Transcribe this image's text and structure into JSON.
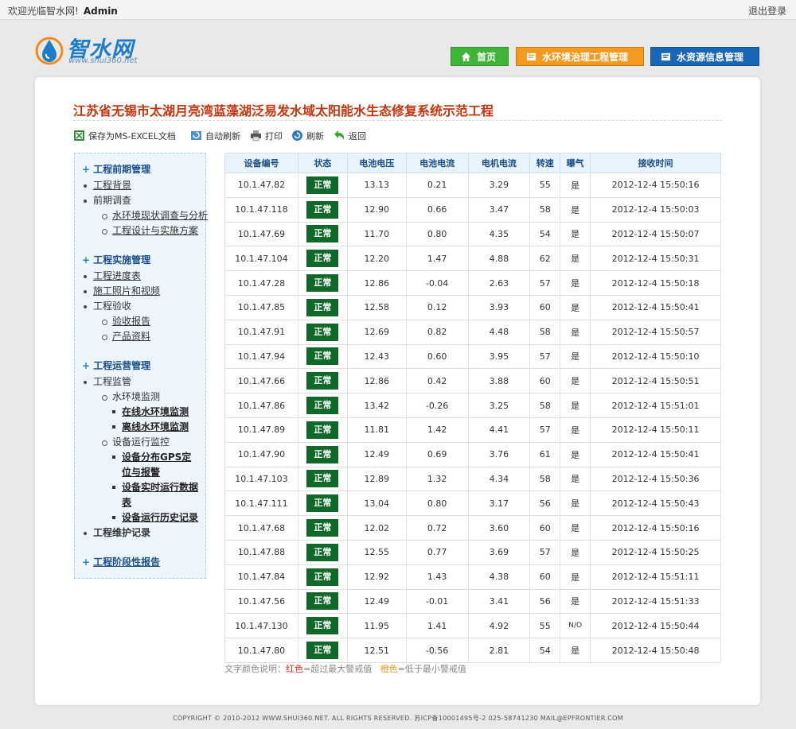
{
  "topbar": {
    "welcome": "欢迎光临智水网!",
    "user": "Admin",
    "logout": "退出登录"
  },
  "logo": {
    "text": "智水网",
    "url_text": "www.shui360.net"
  },
  "nav": {
    "home": "首页",
    "project": "水环境治理工程管理",
    "water_info": "水资源信息管理"
  },
  "page_title": "江苏省无锡市太湖月亮湾蓝藻湖泛易发水域太阳能水生态修复系统示范工程",
  "toolbar": {
    "excel": "保存为MS-EXCEL文档",
    "auto_refresh": "自动刷新",
    "print": "打印",
    "refresh": "刷新",
    "back": "返回"
  },
  "sidebar": {
    "g1": {
      "head": "工程前期管理",
      "bg": "工程背景",
      "survey": "前期调查",
      "survey_a": "水环境现状调查与分析",
      "survey_b": "工程设计与实施方案"
    },
    "g2": {
      "head": "工程实施管理",
      "progress": "工程进度表",
      "photos": "施工照片和视频",
      "accept": "工程验收",
      "accept_a": "验收报告",
      "accept_b": "产品资料"
    },
    "g3": {
      "head": "工程运营管理",
      "monitor": "工程监管",
      "water_mon": "水环境监测",
      "online": "在线水环境监测",
      "offline": "离线水环境监测",
      "dev_mon": "设备运行监控",
      "gps": "设备分布GPS定位与报警",
      "realtime": "设备实时运行数据表",
      "history": "设备运行历史记录",
      "maint": "工程维护记录"
    },
    "g4": {
      "head": "工程阶段性报告"
    }
  },
  "table": {
    "headers": [
      "设备编号",
      "状态",
      "电池电压",
      "电池电流",
      "电机电流",
      "转速",
      "曝气",
      "接收时间"
    ],
    "rows": [
      [
        "10.1.47.82",
        "正常",
        "13.13",
        "0.21",
        "3.29",
        "55",
        "是",
        "2012-12-4 15:50:16"
      ],
      [
        "10.1.47.118",
        "正常",
        "12.90",
        "0.66",
        "3.47",
        "58",
        "是",
        "2012-12-4 15:50:03"
      ],
      [
        "10.1.47.69",
        "正常",
        "11.70",
        "0.80",
        "4.35",
        "54",
        "是",
        "2012-12-4 15:50:07"
      ],
      [
        "10.1.47.104",
        "正常",
        "12.20",
        "1.47",
        "4.88",
        "62",
        "是",
        "2012-12-4 15:50:31"
      ],
      [
        "10.1.47.28",
        "正常",
        "12.86",
        "-0.04",
        "2.63",
        "57",
        "是",
        "2012-12-4 15:50:18"
      ],
      [
        "10.1.47.85",
        "正常",
        "12.58",
        "0.12",
        "3.93",
        "60",
        "是",
        "2012-12-4 15:50:41"
      ],
      [
        "10.1.47.91",
        "正常",
        "12.69",
        "0.82",
        "4.48",
        "58",
        "是",
        "2012-12-4 15:50:57"
      ],
      [
        "10.1.47.94",
        "正常",
        "12.43",
        "0.60",
        "3.95",
        "57",
        "是",
        "2012-12-4 15:50:10"
      ],
      [
        "10.1.47.66",
        "正常",
        "12.86",
        "0.42",
        "3.88",
        "60",
        "是",
        "2012-12-4 15:50:51"
      ],
      [
        "10.1.47.86",
        "正常",
        "13.42",
        "-0.26",
        "3.25",
        "58",
        "是",
        "2012-12-4 15:51:01"
      ],
      [
        "10.1.47.89",
        "正常",
        "11.81",
        "1.42",
        "4.41",
        "57",
        "是",
        "2012-12-4 15:50:11"
      ],
      [
        "10.1.47.90",
        "正常",
        "12.49",
        "0.69",
        "3.76",
        "61",
        "是",
        "2012-12-4 15:50:41"
      ],
      [
        "10.1.47.103",
        "正常",
        "12.89",
        "1.32",
        "4.34",
        "58",
        "是",
        "2012-12-4 15:50:36"
      ],
      [
        "10.1.47.111",
        "正常",
        "13.04",
        "0.80",
        "3.17",
        "56",
        "是",
        "2012-12-4 15:50:43"
      ],
      [
        "10.1.47.68",
        "正常",
        "12.02",
        "0.72",
        "3.60",
        "60",
        "是",
        "2012-12-4 15:50:16"
      ],
      [
        "10.1.47.88",
        "正常",
        "12.55",
        "0.77",
        "3.69",
        "57",
        "是",
        "2012-12-4 15:50:25"
      ],
      [
        "10.1.47.84",
        "正常",
        "12.92",
        "1.43",
        "4.38",
        "60",
        "是",
        "2012-12-4 15:51:11"
      ],
      [
        "10.1.47.56",
        "正常",
        "12.49",
        "-0.01",
        "3.41",
        "56",
        "是",
        "2012-12-4 15:51:33"
      ],
      [
        "10.1.47.130",
        "正常",
        "11.95",
        "1.41",
        "4.92",
        "55",
        "N/O",
        "2012-12-4 15:50:44"
      ],
      [
        "10.1.47.80",
        "正常",
        "12.51",
        "-0.56",
        "2.81",
        "54",
        "是",
        "2012-12-4 15:50:48"
      ]
    ],
    "low_warn_rows": [
      0,
      5,
      8
    ],
    "faint_cell": {
      "row": 18,
      "col": 6
    }
  },
  "legend": {
    "prefix": "文字颜色说明：",
    "red": "红色",
    "red_desc": "=超过最大警戒值",
    "orange": "橙色",
    "orange_desc": "=低于最小警戒值"
  },
  "footer": "COPYRIGHT © 2010-2012 WWW.SHUI360.NET. ALL RIGHTS RESERVED. 苏ICP备10001495号-2   025-58741230   MAIL@EPFRONTIER.COM",
  "colors": {
    "title": "#c8350c",
    "status_badge": "#0f6a2a",
    "warn_low": "#e99a1c",
    "warn_high": "#d9261c",
    "nav_home": "#3eb536",
    "nav_project": "#f59a1e",
    "nav_water": "#1766b8"
  }
}
